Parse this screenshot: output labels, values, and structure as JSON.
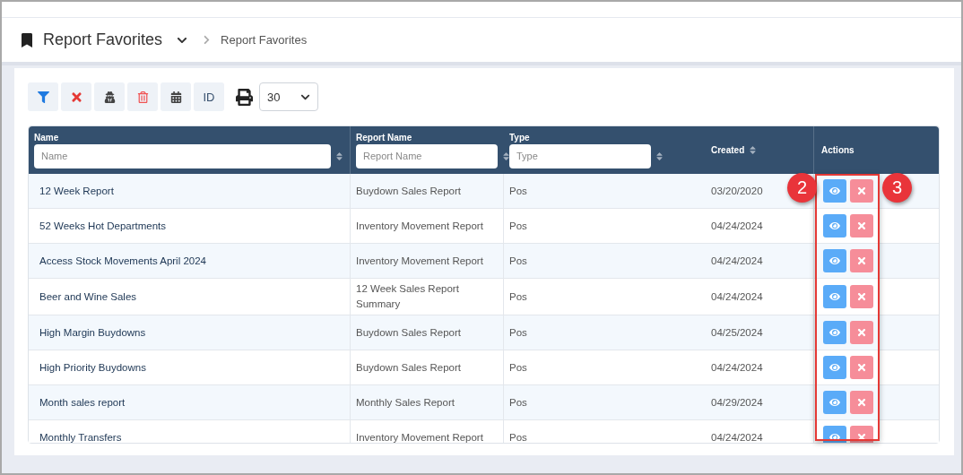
{
  "page": {
    "title": "Report Favorites",
    "breadcrumb": "Report Favorites"
  },
  "toolbar": {
    "buttons": [
      {
        "kind": "filter"
      },
      {
        "kind": "clear"
      },
      {
        "kind": "user"
      },
      {
        "kind": "delete"
      },
      {
        "kind": "calendar"
      },
      {
        "kind": "text",
        "label": "ID"
      }
    ],
    "page_size": "30"
  },
  "table": {
    "columns": [
      {
        "label": "Name",
        "kind": "filter",
        "placeholder": "Name"
      },
      {
        "label": "Report Name",
        "kind": "filter",
        "placeholder": "Report Name"
      },
      {
        "label": "Type",
        "kind": "filter",
        "placeholder": "Type"
      },
      {
        "label": "Created",
        "kind": "sort"
      },
      {
        "label": "Actions",
        "kind": "plain"
      }
    ],
    "rows": [
      {
        "name": "12 Week Report",
        "report_name": "Buydown Sales Report",
        "type": "Pos",
        "created": "03/20/2020"
      },
      {
        "name": "52 Weeks Hot Departments",
        "report_name": "Inventory Movement Report",
        "type": "Pos",
        "created": "04/24/2024"
      },
      {
        "name": "Access Stock Movements April 2024",
        "report_name": "Inventory Movement Report",
        "type": "Pos",
        "created": "04/24/2024"
      },
      {
        "name": "Beer and Wine Sales",
        "report_name": "12 Week Sales Report Summary",
        "type": "Pos",
        "created": "04/24/2024"
      },
      {
        "name": "High Margin Buydowns",
        "report_name": "Buydown Sales Report",
        "type": "Pos",
        "created": "04/25/2024"
      },
      {
        "name": "High Priority Buydowns",
        "report_name": "Buydown Sales Report",
        "type": "Pos",
        "created": "04/24/2024"
      },
      {
        "name": "Month sales report",
        "report_name": "Monthly Sales Report",
        "type": "Pos",
        "created": "04/29/2024"
      },
      {
        "name": "Monthly Transfers",
        "report_name": "Inventory Movement Report",
        "type": "Pos",
        "created": "04/24/2024"
      }
    ]
  },
  "annotations": [
    {
      "label": "2"
    },
    {
      "label": "3"
    }
  ]
}
